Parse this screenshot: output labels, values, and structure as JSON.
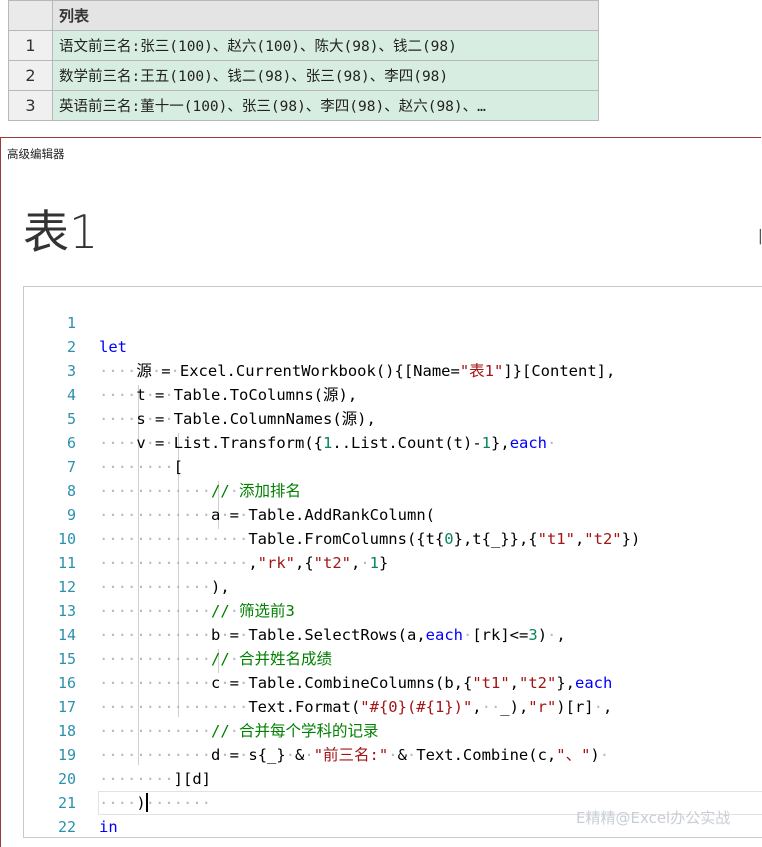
{
  "result_table": {
    "column_header": "列表",
    "rows": [
      {
        "num": "1",
        "value": "语文前三名:张三(100)、赵六(100)、陈大(98)、钱二(98)"
      },
      {
        "num": "2",
        "value": "数学前三名:王五(100)、钱二(98)、张三(98)、李四(98)"
      },
      {
        "num": "3",
        "value": "英语前三名:董十一(100)、张三(98)、李四(98)、赵六(98)、…"
      }
    ]
  },
  "editor": {
    "panel_title": "高级编辑器",
    "query_name": "表1",
    "line_numbers": [
      "1",
      "2",
      "3",
      "4",
      "5",
      "6",
      "7",
      "8",
      "9",
      "10",
      "11",
      "12",
      "13",
      "14",
      "15",
      "16",
      "17",
      "18",
      "19",
      "20",
      "21",
      "22"
    ]
  },
  "watermark": "E精精@Excel办公实战",
  "colors": {
    "keyword": "#0000ff",
    "string": "#a31515",
    "number": "#098658",
    "comment": "#008000",
    "line_number": "#2b91af",
    "table_cell_bg": "#d8ede2"
  }
}
